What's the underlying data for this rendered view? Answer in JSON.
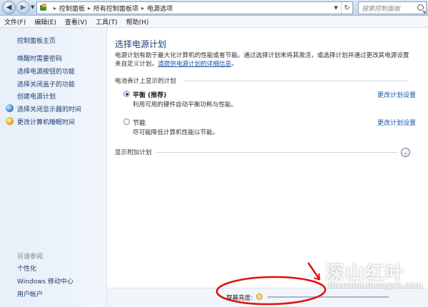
{
  "addressbar": {
    "crumbs": [
      "控制面板",
      "所有控制面板项",
      "电源选项"
    ],
    "search_placeholder": "搜索控制面板"
  },
  "menubar": {
    "items": [
      "文件(F)",
      "编辑(E)",
      "查看(V)",
      "工具(T)",
      "帮助(H)"
    ]
  },
  "sidebar": {
    "home": "控制面板主页",
    "links": [
      {
        "label": "唤醒时需要密码",
        "icon": ""
      },
      {
        "label": "选择电源按钮的功能",
        "icon": ""
      },
      {
        "label": "选择关闭盖子的功能",
        "icon": ""
      },
      {
        "label": "创建电源计划",
        "icon": ""
      },
      {
        "label": "选择关闭显示器的时间",
        "icon": "display-icon"
      },
      {
        "label": "更改计算机睡眠时间",
        "icon": "sleep-icon"
      }
    ],
    "see_also": "另请参阅",
    "bottom_links": [
      "个性化",
      "Windows 移动中心",
      "用户帐户"
    ]
  },
  "main": {
    "title": "选择电源计划",
    "desc_line1": "电源计划有助于最大化计算机的性能或者节能。通过选择计划来将其激活，或选择计划并通过更改其电源设置",
    "desc_line2_prefix": "来自定义计划。",
    "desc_link": "请提供电源计划的详细信息",
    "desc_line2_suffix": "。",
    "battery_section": "电池表计上显示的计划",
    "plans": [
      {
        "name": "平衡 (推荐)",
        "desc": "利用可用的硬件自动平衡功耗与性能。",
        "link": "更改计划设置",
        "selected": true
      },
      {
        "name": "节能",
        "desc": "尽可能降低计算机性能以节能。",
        "link": "更改计划设置",
        "selected": false
      }
    ],
    "additional_section": "显示附加计划"
  },
  "status": {
    "brightness_label": "屏幕亮度:"
  },
  "watermark": {
    "big": "深山红叶",
    "url": "shenshanhongye.com"
  },
  "colors": {
    "link": "#1a55a8",
    "heading": "#1e3d72",
    "annotation": "#e01010"
  }
}
